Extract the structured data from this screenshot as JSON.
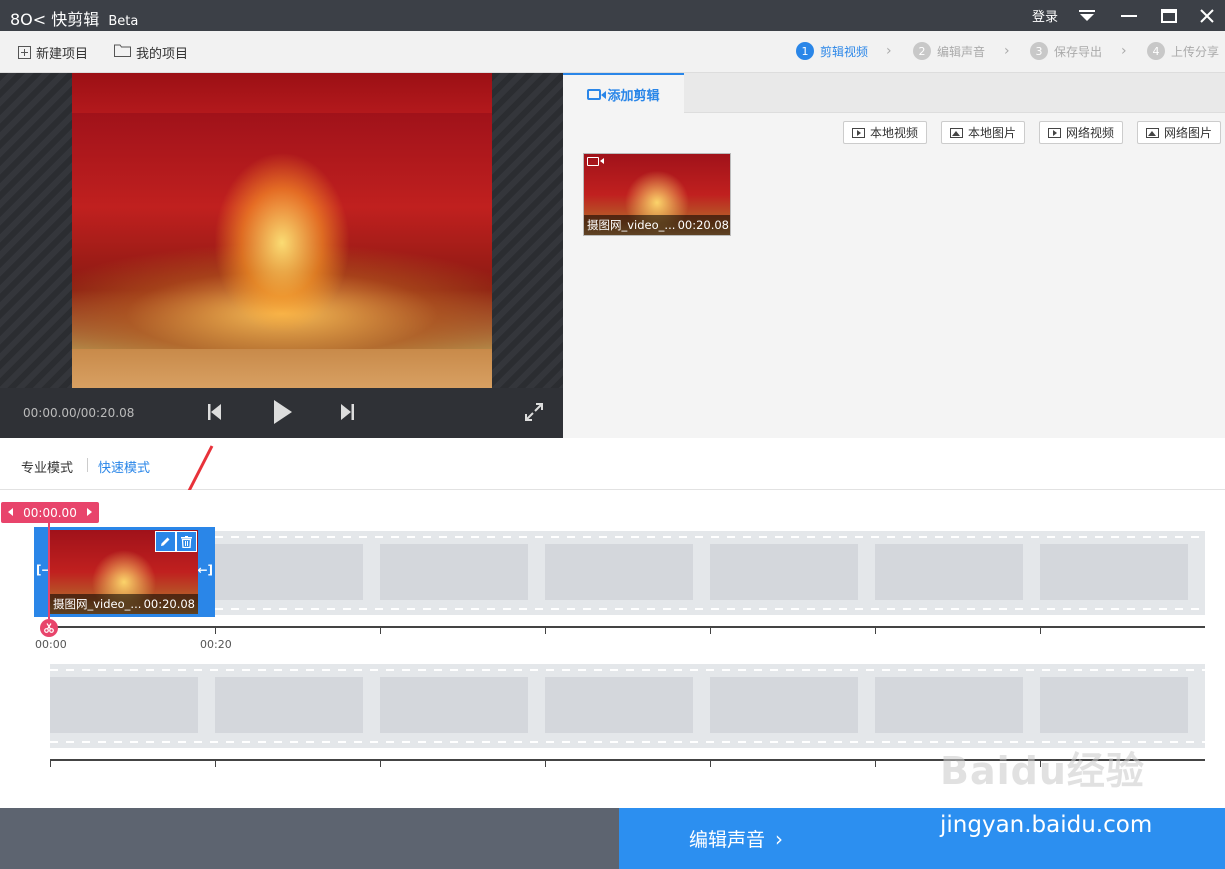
{
  "titlebar": {
    "app_name": "快剪辑",
    "badge": "Beta",
    "login": "登录"
  },
  "toolbar": {
    "new_project": "新建项目",
    "my_projects": "我的项目",
    "steps": [
      {
        "num": "1",
        "label": "剪辑视频",
        "active": true
      },
      {
        "num": "2",
        "label": "编辑声音",
        "active": false
      },
      {
        "num": "3",
        "label": "保存导出",
        "active": false
      },
      {
        "num": "4",
        "label": "上传分享",
        "active": false
      }
    ]
  },
  "preview": {
    "timecode": "00:00.00/00:20.08"
  },
  "library": {
    "tab": "添加剪辑",
    "sources": [
      "本地视频",
      "本地图片",
      "网络视频",
      "网络图片"
    ],
    "items": [
      {
        "name": "摄图网_video_...",
        "duration": "00:20.08"
      }
    ]
  },
  "modes": {
    "pro": "专业模式",
    "fast": "快速模式"
  },
  "timeline": {
    "position": "00:00.00",
    "clip": {
      "name": "摄图网_video_...",
      "duration": "00:20.08"
    },
    "time_labels": [
      "00:00",
      "00:20"
    ]
  },
  "bottom": {
    "next_step": "编辑声音"
  },
  "watermark": {
    "logo": "Baidu经验",
    "url": "jingyan.baidu.com"
  },
  "colors": {
    "accent": "#2a86e8",
    "playhead": "#e8446b",
    "titlebar": "#3c4047"
  }
}
